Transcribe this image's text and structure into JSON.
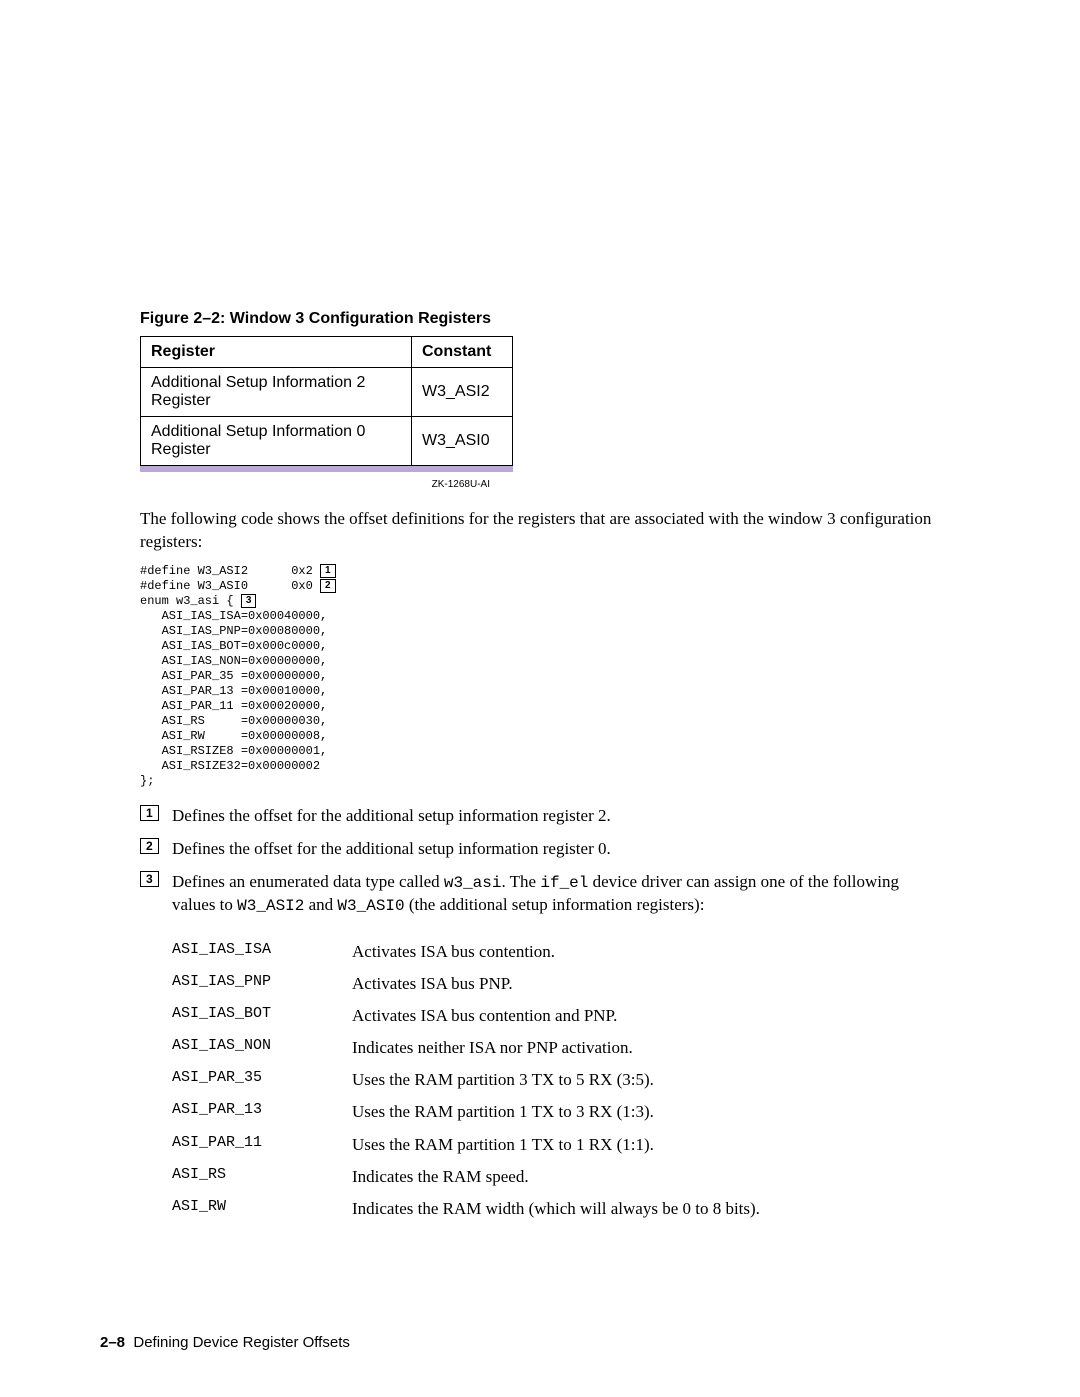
{
  "figure": {
    "caption": "Figure 2–2: Window 3 Configuration Registers",
    "id_label": "ZK-1268U-AI",
    "headers": {
      "register": "Register",
      "constant": "Constant"
    },
    "rows": [
      {
        "register": "Additional Setup Information 2 Register",
        "constant": "W3_ASI2"
      },
      {
        "register": "Additional Setup Information 0 Register",
        "constant": "W3_ASI0"
      }
    ]
  },
  "intro_text": "The following code shows the offset definitions for the registers that are associated with the window 3 configuration registers:",
  "code": {
    "lines_pre": [
      "#define W3_ASI2      0x2 ",
      "#define W3_ASI0      0x0 ",
      "enum w3_asi { "
    ],
    "lines_post": [
      "   ASI_IAS_ISA=0x00040000,",
      "   ASI_IAS_PNP=0x00080000,",
      "   ASI_IAS_BOT=0x000c0000,",
      "   ASI_IAS_NON=0x00000000,",
      "   ASI_PAR_35 =0x00000000,",
      "   ASI_PAR_13 =0x00010000,",
      "   ASI_PAR_11 =0x00020000,",
      "   ASI_RS     =0x00000030,",
      "   ASI_RW     =0x00000008,",
      "   ASI_RSIZE8 =0x00000001,",
      "   ASI_RSIZE32=0x00000002",
      "};"
    ]
  },
  "notes": [
    {
      "num": "1",
      "text": "Defines the offset for the additional setup information register 2."
    },
    {
      "num": "2",
      "text": "Defines the offset for the additional setup information register 0."
    }
  ],
  "note3": {
    "num": "3",
    "pre": "Defines an enumerated data type called ",
    "code1": "w3_asi",
    "mid1": ". The ",
    "code2": "if_el",
    "mid2": " device driver can assign one of the following values to ",
    "code3": "W3_ASI2",
    "mid3": " and ",
    "code4": "W3_ASI0",
    "post": " (the additional setup information registers):"
  },
  "defs": [
    {
      "term": "ASI_IAS_ISA",
      "desc": "Activates ISA bus contention."
    },
    {
      "term": "ASI_IAS_PNP",
      "desc": "Activates ISA bus PNP."
    },
    {
      "term": "ASI_IAS_BOT",
      "desc": "Activates ISA bus contention and PNP."
    },
    {
      "term": "ASI_IAS_NON",
      "desc": "Indicates neither ISA nor PNP activation."
    },
    {
      "term": "ASI_PAR_35",
      "desc": "Uses the RAM partition 3 TX to 5 RX (3:5)."
    },
    {
      "term": "ASI_PAR_13",
      "desc": "Uses the RAM partition 1 TX to 3 RX (1:3)."
    },
    {
      "term": "ASI_PAR_11",
      "desc": "Uses the RAM partition 1 TX to 1 RX (1:1)."
    },
    {
      "term": "ASI_RS",
      "desc": "Indicates the RAM speed."
    },
    {
      "term": "ASI_RW",
      "desc": "Indicates the RAM width (which will always be 0 to 8 bits)."
    }
  ],
  "footer": {
    "page": "2–8",
    "title": "Defining Device Register Offsets"
  }
}
